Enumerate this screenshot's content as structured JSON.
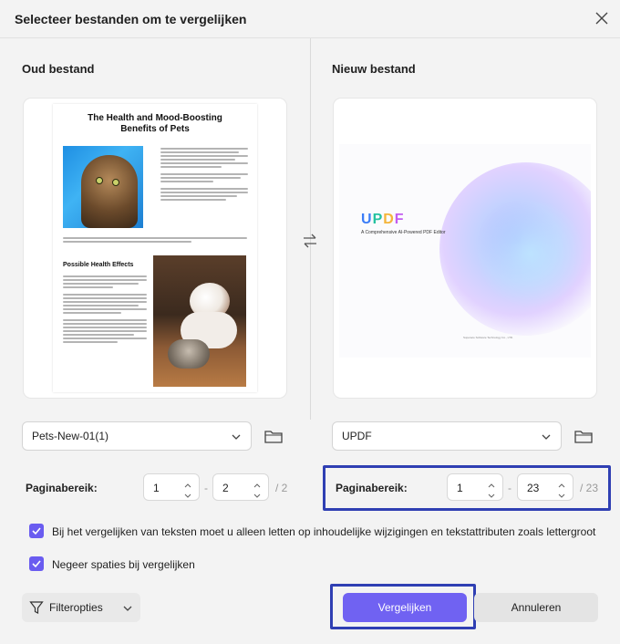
{
  "dialog": {
    "title": "Selecteer bestanden om te vergelijken"
  },
  "old_file": {
    "heading": "Oud bestand",
    "preview": {
      "title_line1": "The Health and Mood-Boosting",
      "title_line2": "Benefits of Pets",
      "section_heading": "Possible Health Effects"
    },
    "selected_file": "Pets-New-01(1)",
    "range_label": "Paginabereik:",
    "range_from": "1",
    "range_to": "2",
    "range_total": "/ 2"
  },
  "new_file": {
    "heading": "Nieuw bestand",
    "preview": {
      "logo": [
        "U",
        "P",
        "D",
        "F"
      ],
      "tagline": "A Comprehensive AI-Powered PDF Editor",
      "footer": "Superace Software Technology Co., LTD."
    },
    "selected_file": "UPDF",
    "range_label": "Paginabereik:",
    "range_from": "1",
    "range_to": "23",
    "range_total": "/ 23"
  },
  "range_separator": "-",
  "options": {
    "content_only": {
      "checked": true,
      "label": "Bij het vergelijken van teksten moet u alleen letten op inhoudelijke wijzigingen en tekstattributen zoals lettergroot"
    },
    "ignore_spaces": {
      "checked": true,
      "label": "Negeer spaties bij vergelijken"
    }
  },
  "footer": {
    "filter_label": "Filteropties",
    "compare_label": "Vergelijken",
    "cancel_label": "Annuleren"
  },
  "colors": {
    "accent": "#7062f2",
    "highlight": "#2f3fb3"
  }
}
